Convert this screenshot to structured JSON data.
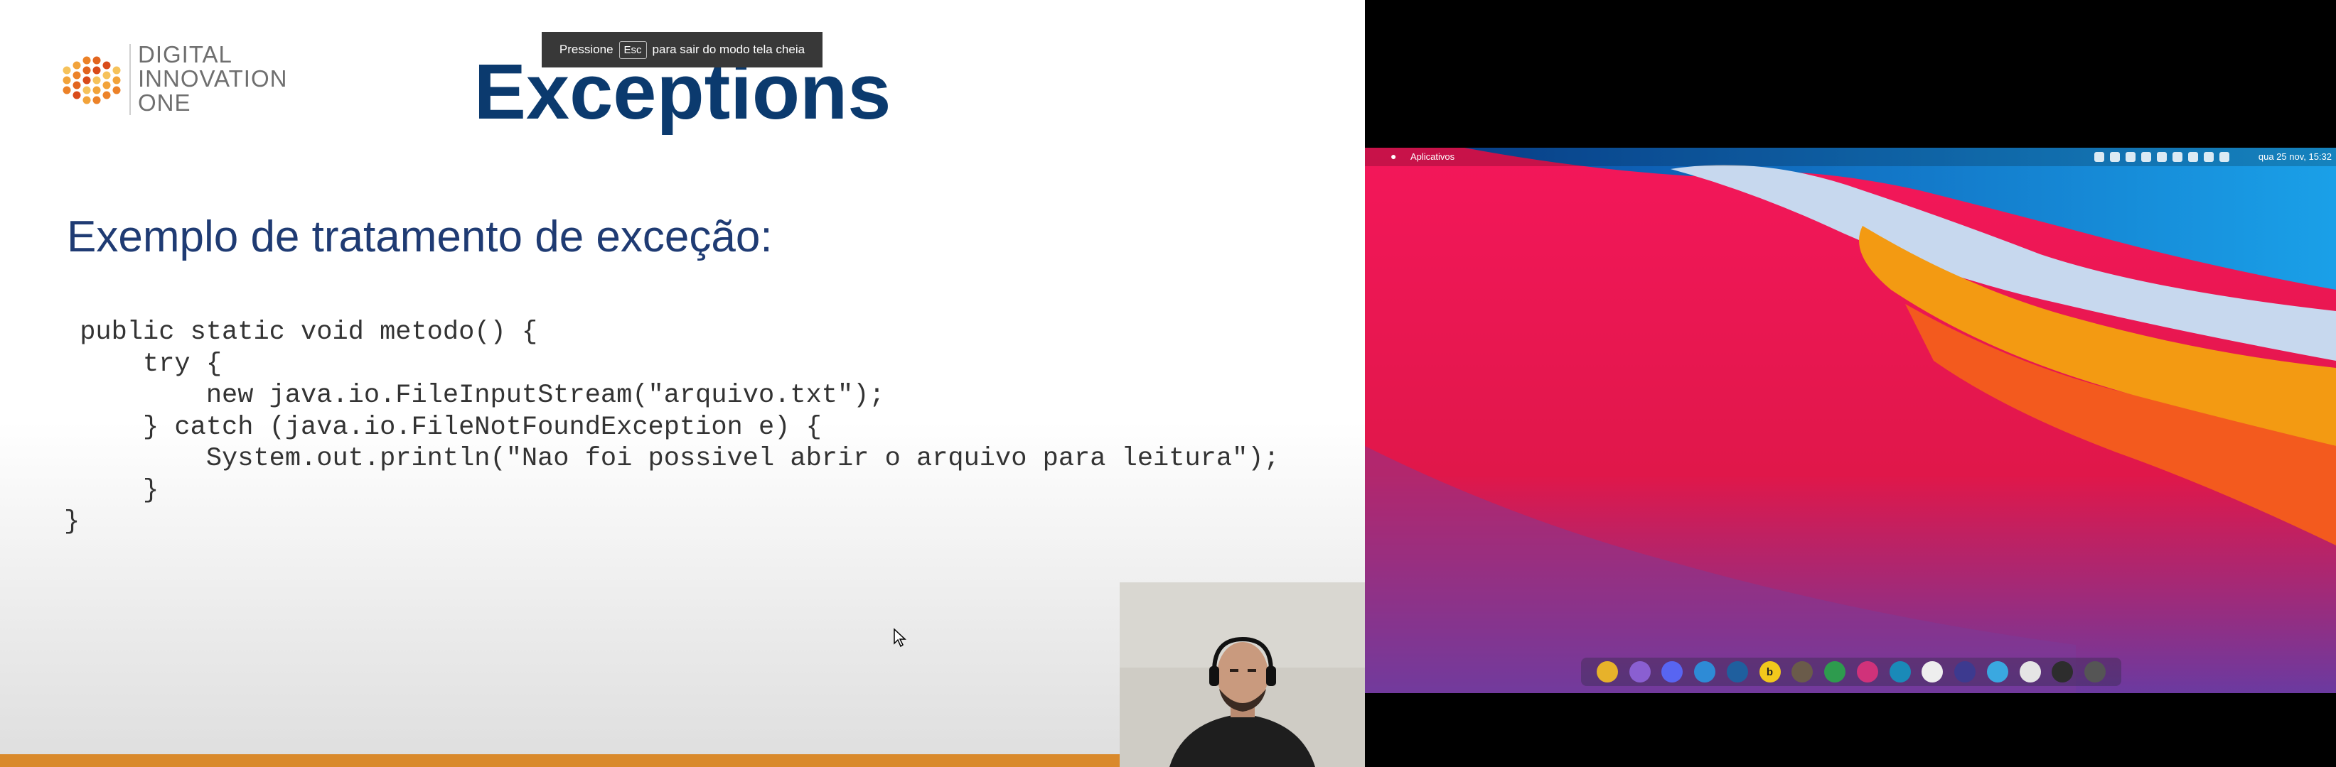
{
  "slide": {
    "logo": {
      "line1": "DIGITAL",
      "line2": "INNOVATION",
      "line3": "ONE"
    },
    "title": "Exceptions",
    "subtitle": "Exemplo de tratamento de exceção:",
    "code_lines": [
      " public static void metodo() {",
      "",
      "     try {",
      "         new java.io.FileInputStream(\"arquivo.txt\");",
      "     } catch (java.io.FileNotFoundException e) {",
      "         System.out.println(\"Nao foi possivel abrir o arquivo para leitura\");",
      "     }",
      "}"
    ],
    "accent_color": "#d9892b",
    "title_color": "#0b3a6e"
  },
  "fullscreen_toast": {
    "before": "Pressione",
    "key": "Esc",
    "after": "para sair do modo tela cheia"
  },
  "desktop": {
    "topbar": {
      "apple_icon": "apple-logo-icon",
      "apps_label": "Aplicativos",
      "clock": "qua 25 nov, 15:32",
      "tray_icons": [
        "keyboard-icon",
        "discord-icon",
        "unity-icon",
        "wifi-icon",
        "bluetooth-icon",
        "battery-icon",
        "shield-icon",
        "network-icon",
        "volume-icon"
      ]
    },
    "dock": {
      "icons": [
        {
          "name": "chrome-icon",
          "color": "#e7b22a"
        },
        {
          "name": "gnome-icon",
          "color": "#8a5fd1"
        },
        {
          "name": "discord-icon",
          "color": "#5865f2"
        },
        {
          "name": "files-icon",
          "color": "#2e8bd6"
        },
        {
          "name": "vscode-icon",
          "color": "#1f5f9e"
        },
        {
          "name": "beekeeper-icon",
          "color": "#f2c81c",
          "glyph": "b"
        },
        {
          "name": "gimp-icon",
          "color": "#6a5b4a"
        },
        {
          "name": "mongodb-icon",
          "color": "#2e9b4e"
        },
        {
          "name": "intellij-icon",
          "color": "#d0327a"
        },
        {
          "name": "cube-icon",
          "color": "#1a8ab8"
        },
        {
          "name": "typora-icon",
          "color": "#eeeeee"
        },
        {
          "name": "moon-icon",
          "color": "#3d3a8f"
        },
        {
          "name": "globe-icon",
          "color": "#3aa8e0"
        },
        {
          "name": "circle-icon",
          "color": "#e5e5e5"
        },
        {
          "name": "terminal-icon",
          "color": "#2d2d2d"
        },
        {
          "name": "settings-icon",
          "color": "#555555"
        }
      ]
    }
  }
}
